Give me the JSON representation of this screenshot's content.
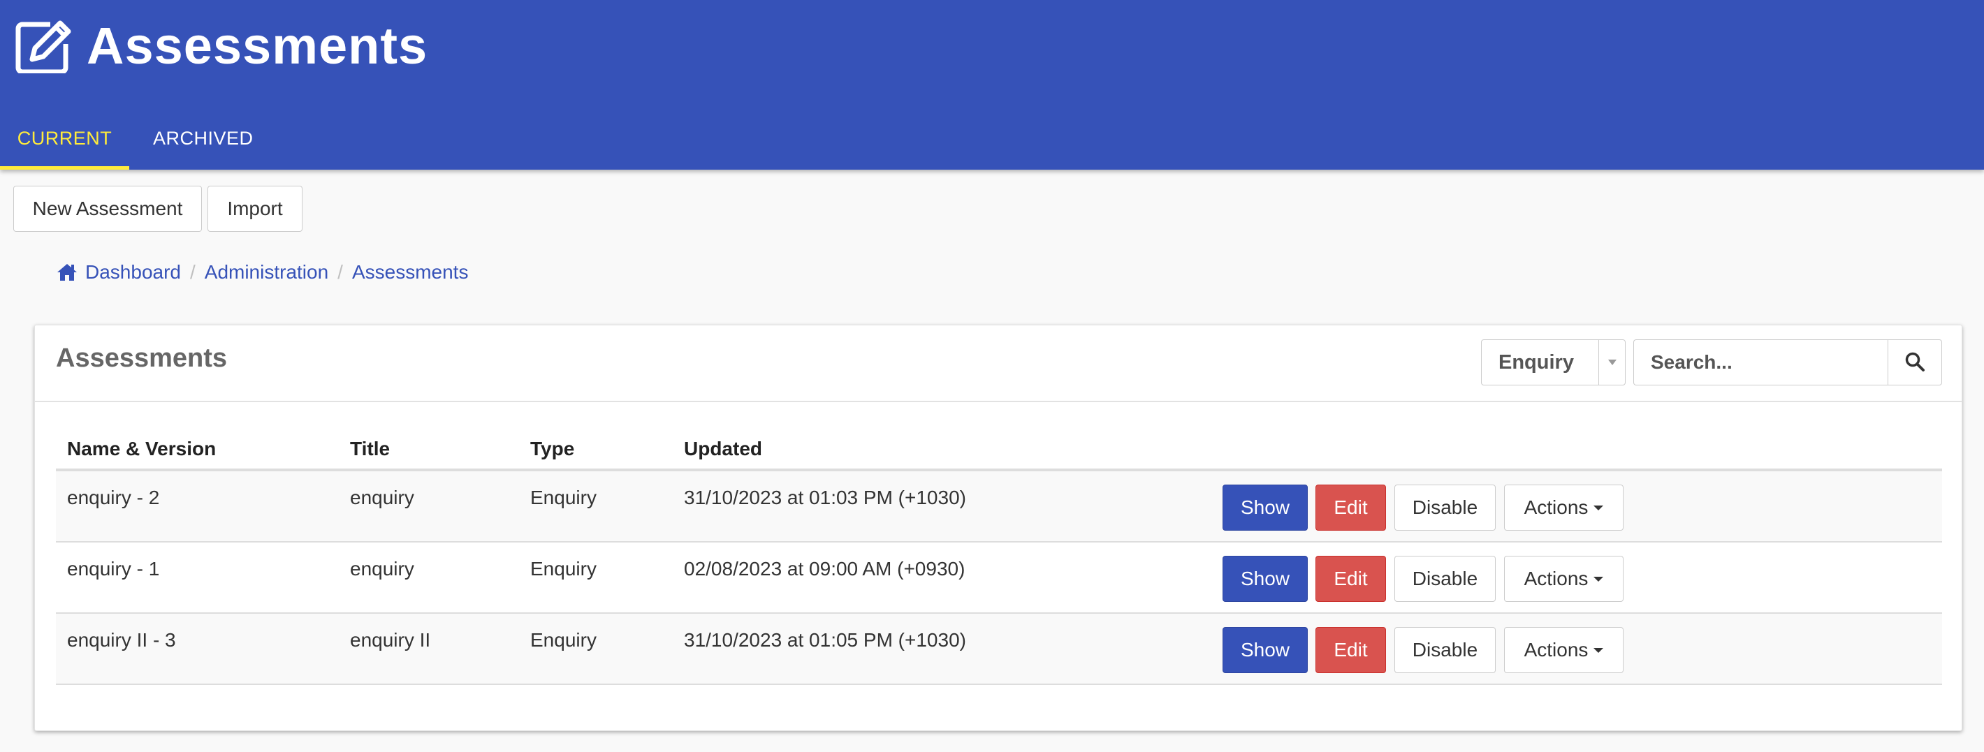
{
  "header": {
    "title": "Assessments",
    "icon": "edit-icon",
    "tabs": [
      {
        "label": "CURRENT",
        "active": true
      },
      {
        "label": "ARCHIVED",
        "active": false
      }
    ]
  },
  "toolbar": {
    "new_label": "New Assessment",
    "import_label": "Import"
  },
  "breadcrumb": {
    "home_icon": "home-icon",
    "items": [
      "Dashboard",
      "Administration",
      "Assessments"
    ]
  },
  "panel": {
    "title": "Assessments",
    "filter": {
      "selected": "Enquiry"
    },
    "search": {
      "placeholder": "Search...",
      "icon": "search-icon"
    }
  },
  "table": {
    "columns": [
      "Name & Version",
      "Title",
      "Type",
      "Updated"
    ],
    "rows": [
      {
        "name": "enquiry - 2",
        "title": "enquiry",
        "type": "Enquiry",
        "updated": "31/10/2023 at 01:03 PM (+1030)"
      },
      {
        "name": "enquiry - 1",
        "title": "enquiry",
        "type": "Enquiry",
        "updated": "02/08/2023 at 09:00 AM (+0930)"
      },
      {
        "name": "enquiry II - 3",
        "title": "enquiry II",
        "type": "Enquiry",
        "updated": "31/10/2023 at 01:05 PM (+1030)"
      }
    ],
    "row_actions": {
      "show": "Show",
      "edit": "Edit",
      "disable": "Disable",
      "actions": "Actions"
    }
  },
  "colors": {
    "primary": "#3652b8",
    "accent": "#ffeb3b",
    "danger": "#d9534f"
  }
}
